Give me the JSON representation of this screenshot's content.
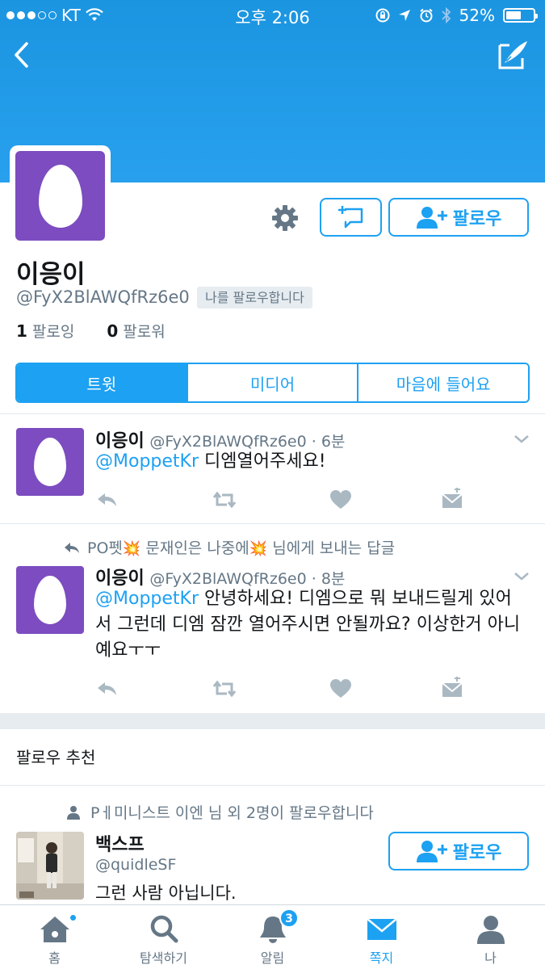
{
  "status_bar": {
    "carrier": "KT",
    "time": "오후 2:06",
    "battery": "52%"
  },
  "profile": {
    "name": "이응이",
    "handle": "@FyX2BlAWQfRz6e0",
    "follows_you": "나를 팔로우합니다",
    "following_count": "1",
    "following_label": "팔로잉",
    "followers_count": "0",
    "followers_label": "팔로워",
    "follow_label": "팔로우"
  },
  "tabs": [
    {
      "label": "트윗",
      "active": true
    },
    {
      "label": "미디어",
      "active": false
    },
    {
      "label": "마음에 들어요",
      "active": false
    }
  ],
  "tweets": [
    {
      "name": "이응이",
      "meta": "@FyX2BlAWQfRz6e0 · 6분",
      "mention": "@MoppetKr",
      "text": " 디엠열어주세요!"
    },
    {
      "reply_context_before": "PO펫",
      "reply_context_mid": " 문재인은 나중에",
      "reply_context_after": "  님에게 보내는 답글",
      "name": "이응이",
      "meta": "@FyX2BlAWQfRz6e0 · 8분",
      "mention": "@MoppetKr",
      "text": "  안녕하세요! 디엠으로 뭐 보내드릴게 있어서 그런데 디엠 잠깐 열어주시면 안될까요? 이상한거 아니예요ㅜㅜ"
    }
  ],
  "suggestions": {
    "title": "팔로우 추천",
    "social_context": "Pㅔ미니스트 이엔 님 외 2명이 팔로우합니다",
    "name": "백스프",
    "handle": "@quidleSF",
    "bio": "그런 사람 아닙니다.",
    "follow_label": "팔로우"
  },
  "tabbar": [
    {
      "label": "홈",
      "icon": "home-icon",
      "active": false
    },
    {
      "label": "탐색하기",
      "icon": "search-icon",
      "active": false
    },
    {
      "label": "알림",
      "icon": "bell-icon",
      "active": false,
      "badge": "3"
    },
    {
      "label": "쪽지",
      "icon": "envelope-icon",
      "active": true
    },
    {
      "label": "나",
      "icon": "person-icon",
      "active": false
    }
  ],
  "colors": {
    "accent": "#1da1f2",
    "avatar": "#7c4cc0",
    "banner": "#1b95e0"
  }
}
